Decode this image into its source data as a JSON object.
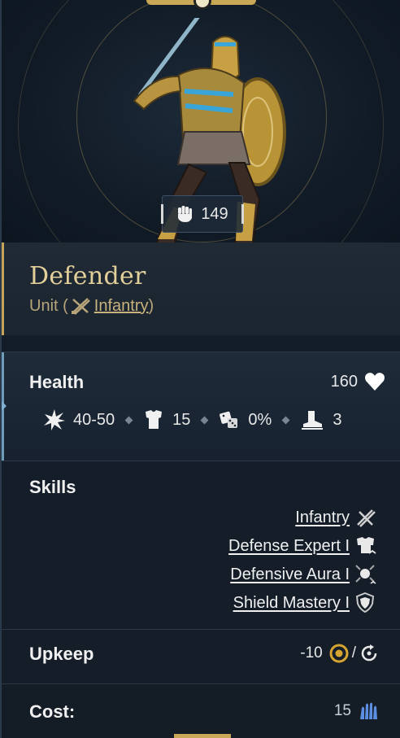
{
  "unit": {
    "power": "149",
    "name": "Defender",
    "type_prefix": "Unit (",
    "type_link": "Infantry",
    "type_suffix": ")"
  },
  "health": {
    "label": "Health",
    "value": "160",
    "stats": [
      {
        "icon": "damage-burst-icon",
        "value": "40-50"
      },
      {
        "icon": "armor-icon",
        "value": "15"
      },
      {
        "icon": "dice-icon",
        "value": "0%"
      },
      {
        "icon": "movement-boot-icon",
        "value": "3"
      }
    ]
  },
  "skills": {
    "label": "Skills",
    "items": [
      {
        "label": "Infantry",
        "icon": "crossed-swords-icon"
      },
      {
        "label": "Defense Expert I",
        "icon": "defense-expert-icon"
      },
      {
        "label": "Defensive Aura I",
        "icon": "defensive-aura-icon"
      },
      {
        "label": "Shield Mastery I",
        "icon": "shield-mastery-icon"
      }
    ]
  },
  "upkeep": {
    "label": "Upkeep",
    "value": "-10",
    "separator": "/"
  },
  "cost": {
    "label": "Cost:",
    "value": "15"
  },
  "colors": {
    "gold": "#e2cf9a",
    "gold_accent": "#c5a35a",
    "blue_accent": "#6f9bb8",
    "cost_blue": "#5b8ee0",
    "upkeep_gold": "#d6a531"
  }
}
